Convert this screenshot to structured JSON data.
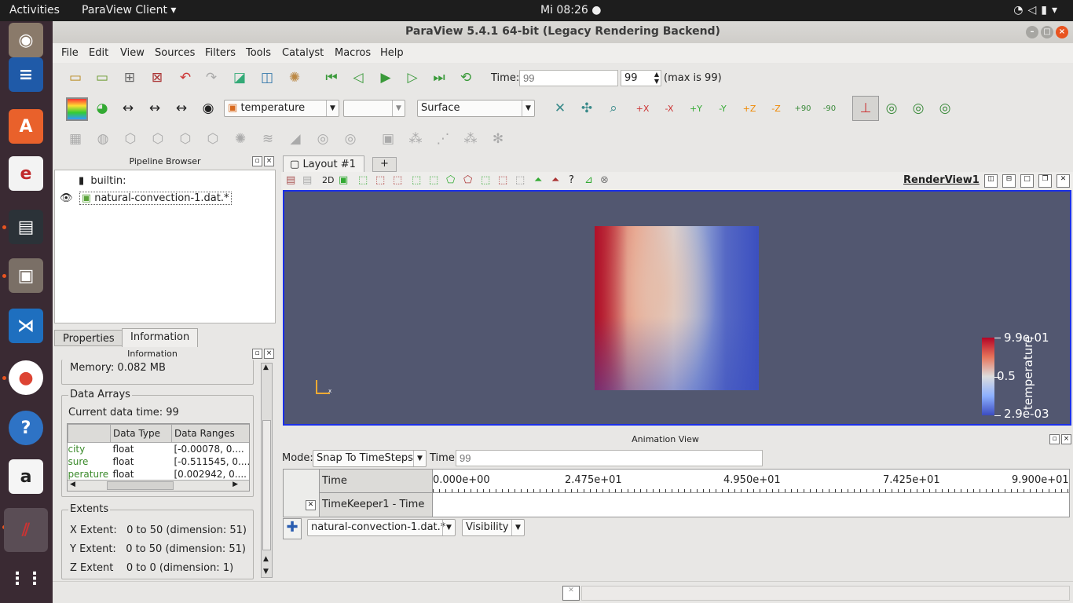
{
  "system": {
    "activities": "Activities",
    "app_menu": "ParaView Client ▾",
    "clock": "Mi 08:26 ●"
  },
  "window": {
    "title": "ParaView 5.4.1 64-bit (Legacy Rendering Backend)"
  },
  "menu": [
    "File",
    "Edit",
    "View",
    "Sources",
    "Filters",
    "Tools",
    "Catalyst",
    "Macros",
    "Help"
  ],
  "time_toolbar": {
    "label": "Time:",
    "value_placeholder": "99",
    "step": "99",
    "max": "(max is 99)"
  },
  "display_toolbar": {
    "array": "temperature",
    "component": "",
    "representation": "Surface",
    "buttons": [
      "+X",
      "-X",
      "+Y",
      "-Y",
      "+Z",
      "-Z",
      "+90",
      "-90"
    ]
  },
  "pipeline_browser": {
    "title": "Pipeline Browser",
    "items": [
      {
        "label": "builtin:"
      },
      {
        "label": "natural-convection-1.dat.*"
      }
    ]
  },
  "left_tabs": [
    "Properties",
    "Information"
  ],
  "information": {
    "title": "Information",
    "memory": "Memory:  0.082 MB",
    "data_arrays_title": "Data Arrays",
    "current_time": "Current data time: 99",
    "columns": [
      "",
      "Data Type",
      "Data Ranges"
    ],
    "rows": [
      [
        "city",
        "float",
        "[-0.00078, 0...."
      ],
      [
        "sure",
        "float",
        "[-0.511545, 0...."
      ],
      [
        "perature",
        "float",
        "[0.002942, 0...."
      ]
    ],
    "extents_title": "Extents",
    "extents": [
      "X Extent:   0 to 50 (dimension: 51)",
      "Y Extent:   0 to 50 (dimension: 51)",
      "Z Extent    0 to 0 (dimension: 1)"
    ]
  },
  "layout": {
    "tab": "Layout #1",
    "add_tab": "+",
    "view_name": "RenderView1",
    "btn_2d": "2D"
  },
  "colorbar": {
    "max": "9.9e-01",
    "mid": "0.5",
    "min": "2.9e-03",
    "title": "temperature"
  },
  "animation": {
    "title": "Animation View",
    "mode_label": "Mode:",
    "mode": "Snap To TimeSteps",
    "time_label": "Time",
    "time_value": "99",
    "time_header": "Time",
    "ticks": [
      "0.000e+00",
      "2.475e+01",
      "4.950e+01",
      "7.425e+01",
      "9.900e+01"
    ],
    "track": "TimeKeeper1 - Time",
    "source": "natural-convection-1.dat.*",
    "property": "Visibility"
  },
  "colors": {
    "background": "#525770",
    "accent": "#1a2fe8"
  }
}
